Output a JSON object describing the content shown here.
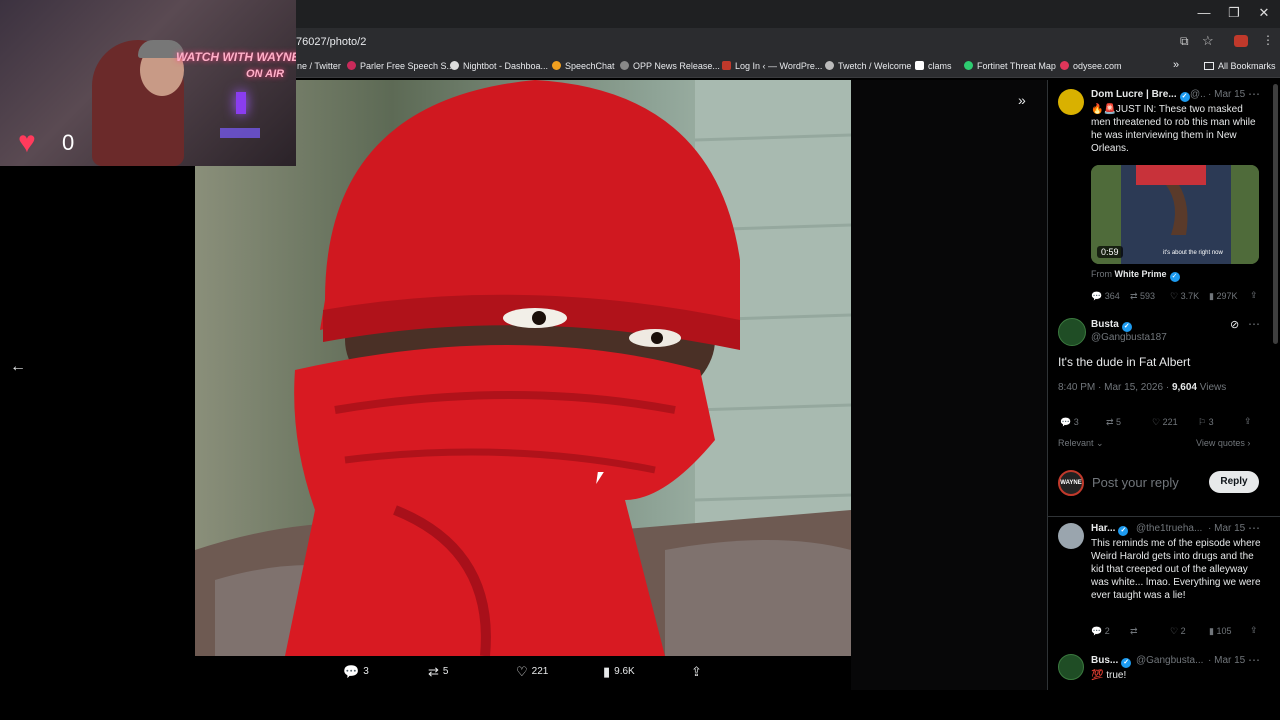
{
  "browser": {
    "url": "76027/photo/2",
    "bookmarks": [
      {
        "label": "ne / Twitter",
        "color": ""
      },
      {
        "label": "Parler Free Speech S...",
        "color": "#c82a5a"
      },
      {
        "label": "Nightbot - Dashboa...",
        "color": "#dddddd"
      },
      {
        "label": "SpeechChat",
        "color": "#f0a020"
      },
      {
        "label": "OPP News Release...",
        "color": "#888888"
      },
      {
        "label": "Log In ‹ — WordPre...",
        "color": "#c0392b"
      },
      {
        "label": "Twetch / Welcome",
        "color": "#bbbbbb"
      },
      {
        "label": "clams",
        "color": "#ffffff"
      },
      {
        "label": "Fortinet Threat Map",
        "color": "#2ecc71"
      },
      {
        "label": "odysee.com",
        "color": "#e0365a"
      }
    ],
    "all_bookmarks": "All Bookmarks"
  },
  "overlay": {
    "line1": "WATCH WITH WAYNE",
    "line2": "ON AIR",
    "heart_count": "0"
  },
  "photo_actions": {
    "replies": "3",
    "reposts": "5",
    "likes": "221",
    "views": "9.6K"
  },
  "quoted": {
    "author": "Dom Lucre | Bre...",
    "handle": "@..",
    "date": "· Mar 15",
    "text": "🔥🚨JUST IN: These two masked men threatened to rob this man while he was interviewing them in New Orleans.",
    "video_duration": "0:59",
    "video_caption": "it's about the right now",
    "from_label": "From",
    "from_name": "White Prime",
    "replies": "364",
    "reposts": "593",
    "likes": "3.7K",
    "views": "297K"
  },
  "main_tweet": {
    "author": "Busta",
    "handle": "@Gangbusta187",
    "text": "It's the dude in Fat Albert",
    "time": "8:40 PM · Mar 15, 2026 ·",
    "views_count": "9,604",
    "views_label": "Views",
    "replies": "3",
    "reposts": "5",
    "likes": "221",
    "bookmarks": "3"
  },
  "sort": {
    "label": "Relevant",
    "view_quotes": "View quotes"
  },
  "composer": {
    "avatar_text": "WAYNE",
    "placeholder": "Post your reply",
    "button": "Reply"
  },
  "reply1": {
    "author": "Har...",
    "handle": "@the1trueha...",
    "date": "· Mar 15",
    "text": "This reminds me of the episode where Weird Harold gets into drugs and the kid that creeped out of the alleyway was white... lmao. Everything we were ever taught was a lie!",
    "replies": "2",
    "likes": "2",
    "views": "105"
  },
  "reply2": {
    "author": "Bus...",
    "handle": "@Gangbusta...",
    "date": "· Mar 15",
    "text": "💯 true!"
  },
  "colors": {
    "accent": "#1d9bf0",
    "bg": "#000000",
    "muted": "#71767b"
  }
}
